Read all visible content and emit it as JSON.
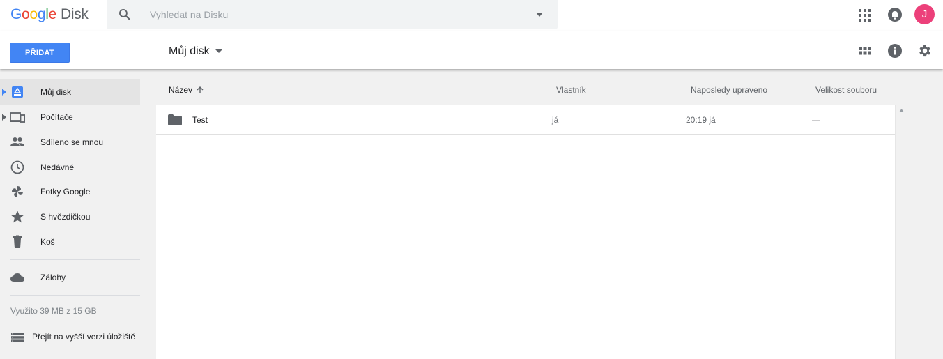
{
  "header": {
    "logo": {
      "google": [
        "G",
        "o",
        "o",
        "g",
        "l",
        "e"
      ],
      "product": "Disk"
    },
    "search": {
      "placeholder": "Vyhledat na Disku",
      "value": ""
    },
    "avatar_initial": "J",
    "icons": [
      "search-icon",
      "chevron-down-icon",
      "apps-grid-icon",
      "notifications-icon"
    ]
  },
  "toolbar": {
    "new_button": "PŘIDAT",
    "breadcrumb": "Můj disk",
    "icons": [
      "grid-view-icon",
      "info-icon",
      "settings-icon"
    ]
  },
  "sidebar": {
    "items": [
      {
        "label": "Můj disk",
        "icon": "drive-icon",
        "expandable": true,
        "active": true
      },
      {
        "label": "Počítače",
        "icon": "computers-icon",
        "expandable": true,
        "active": false
      },
      {
        "label": "Sdíleno se mnou",
        "icon": "people-icon",
        "expandable": false,
        "active": false
      },
      {
        "label": "Nedávné",
        "icon": "clock-icon",
        "expandable": false,
        "active": false
      },
      {
        "label": "Fotky Google",
        "icon": "pinwheel-icon",
        "expandable": false,
        "active": false
      },
      {
        "label": "S hvězdičkou",
        "icon": "star-icon",
        "expandable": false,
        "active": false
      },
      {
        "label": "Koš",
        "icon": "trash-icon",
        "expandable": false,
        "active": false
      },
      {
        "label": "Zálohy",
        "icon": "cloud-icon",
        "expandable": false,
        "active": false
      }
    ],
    "quota": "Využito 39 MB z 15 GB",
    "upgrade": "Přejít na vyšší verzi úložiště"
  },
  "main": {
    "columns": {
      "name": "Název",
      "owner": "Vlastník",
      "modified": "Naposledy upraveno",
      "size": "Velikost souboru"
    },
    "sort": "ascending",
    "rows": [
      {
        "name": "Test",
        "type": "folder",
        "owner": "já",
        "modified": "20:19 já",
        "size": "—"
      }
    ]
  },
  "colors": {
    "primary": "#4285f4",
    "avatar": "#ec407a",
    "sidebar_bg": "#f1f1f1",
    "active_bg": "#e4e4e4",
    "icon": "#5f6368"
  }
}
